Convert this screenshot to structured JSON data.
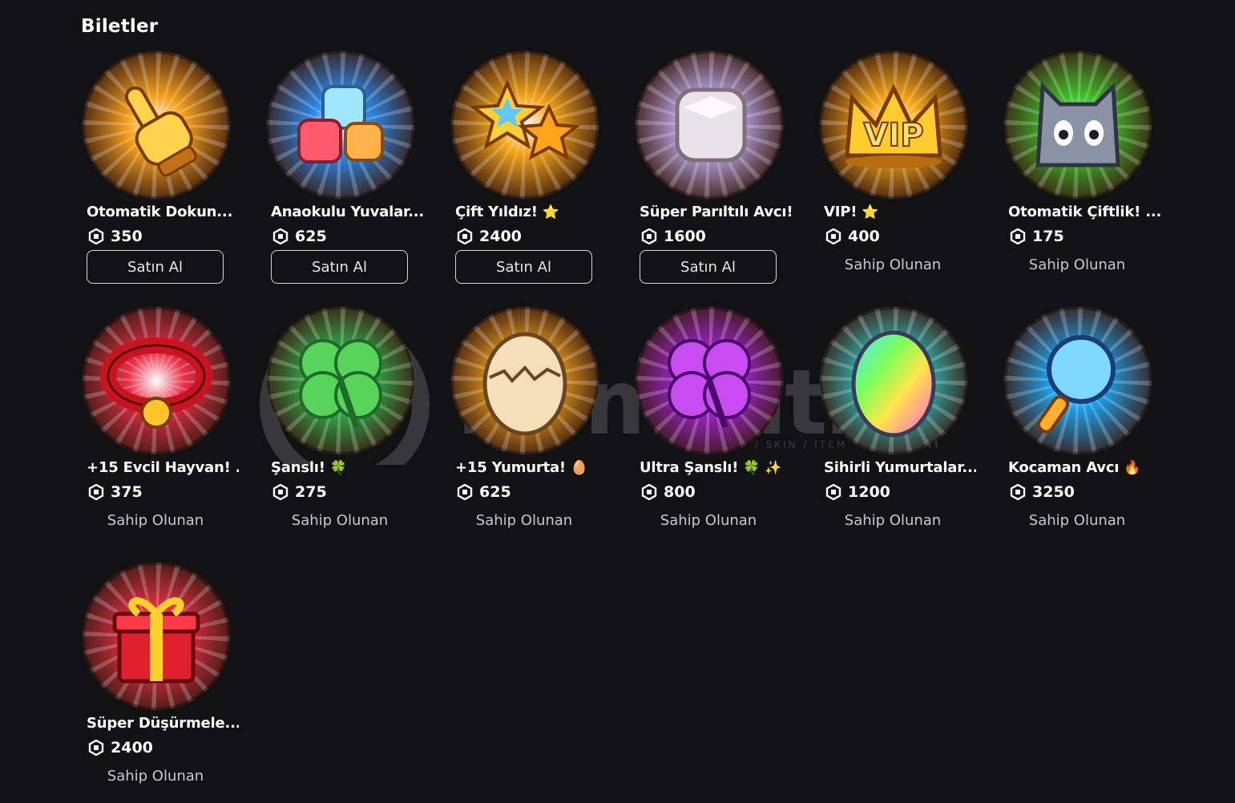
{
  "section_title": "Biletler",
  "buy_label": "Satın Al",
  "owned_label": "Sahip Olunan",
  "watermark": {
    "text": "itemsatis",
    "sub": "HESAP / SKIN / ITEM",
    "suffix": ".com"
  },
  "items": [
    {
      "name": "Otomatik Dokun...",
      "emoji": "",
      "price": "350",
      "status": "buy",
      "icon": "pointing-hand-icon",
      "theme": "#f7a21b"
    },
    {
      "name": "Anaokulu Yuvalar...",
      "emoji": "",
      "price": "625",
      "status": "buy",
      "icon": "dice-blocks-icon",
      "theme": "#2a8cf0"
    },
    {
      "name": "Çift Yıldız!",
      "emoji": "⭐",
      "price": "2400",
      "status": "buy",
      "icon": "double-star-icon",
      "theme": "#f4a416"
    },
    {
      "name": "Süper Parıltılı Avcı!",
      "emoji": "",
      "price": "1600",
      "status": "buy",
      "icon": "shiny-dice-icon",
      "theme": "#b9a6e6"
    },
    {
      "name": "VIP!",
      "emoji": "⭐",
      "price": "400",
      "status": "owned",
      "icon": "vip-crown-icon",
      "theme": "#f6a614"
    },
    {
      "name": "Otomatik Çiftlik! ...",
      "emoji": "",
      "price": "175",
      "status": "owned",
      "icon": "cat-block-icon",
      "theme": "#3fc32a"
    },
    {
      "name": "+15 Evcil Hayvan! ...",
      "emoji": "",
      "price": "375",
      "status": "owned",
      "icon": "pet-collar-icon",
      "theme": "#e8304a"
    },
    {
      "name": "Şanslı!",
      "emoji": "🍀",
      "price": "275",
      "status": "owned",
      "icon": "clover-icon",
      "theme": "#2fb44c"
    },
    {
      "name": "+15 Yumurta!",
      "emoji": "🥚",
      "price": "625",
      "status": "owned",
      "icon": "egg-icon",
      "theme": "#f2a31c"
    },
    {
      "name": "Ultra Şanslı!",
      "emoji": "🍀 ✨",
      "price": "800",
      "status": "owned",
      "icon": "purple-clover-icon",
      "theme": "#a323d8"
    },
    {
      "name": "Sihirli Yumurtalar...",
      "emoji": "",
      "price": "1200",
      "status": "owned",
      "icon": "rainbow-egg-icon",
      "theme": "#2fc2c0"
    },
    {
      "name": "Kocaman Avcı",
      "emoji": "🔥",
      "price": "3250",
      "status": "owned",
      "icon": "magnifier-icon",
      "theme": "#1d9fe8"
    },
    {
      "name": "Süper Düşürmele...",
      "emoji": "",
      "price": "2400",
      "status": "owned",
      "icon": "gift-box-icon",
      "theme": "#e52f45"
    }
  ]
}
